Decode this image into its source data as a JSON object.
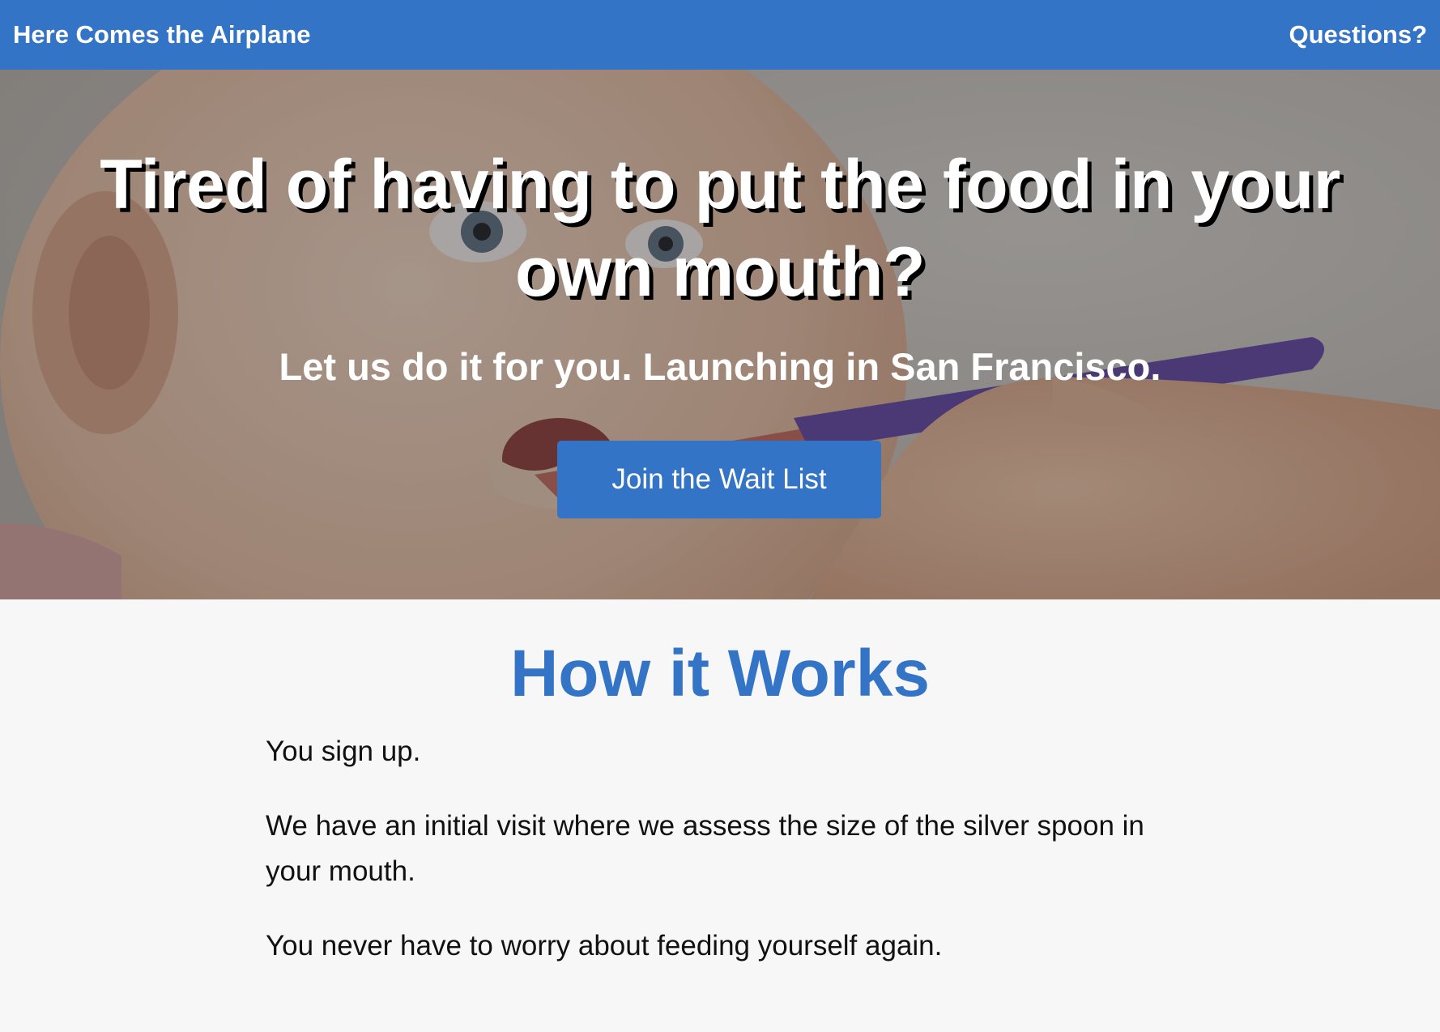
{
  "header": {
    "brand": "Here Comes the Airplane",
    "nav_link": "Questions?"
  },
  "hero": {
    "title": "Tired of having to put the food in your own mouth?",
    "subtitle": "Let us do it for you. Launching in San Francisco.",
    "cta_label": "Join the Wait List"
  },
  "how_it_works": {
    "title": "How it Works",
    "steps": [
      "You sign up.",
      "We have an initial visit where we assess the size of the silver spoon in your mouth.",
      "You never have to worry about feeding yourself again."
    ]
  },
  "colors": {
    "brand_blue": "#3474c6",
    "page_background": "#f7f7f7",
    "text": "#111111"
  }
}
